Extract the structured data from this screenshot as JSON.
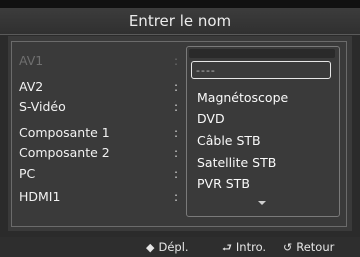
{
  "title": "Entrer le nom",
  "sources": [
    {
      "label": "AV1"
    },
    {
      "label": "AV2"
    },
    {
      "label": "S-Vidéo"
    },
    {
      "label": "Composante 1"
    },
    {
      "label": "Composante 2"
    },
    {
      "label": "PC"
    },
    {
      "label": "HDMI1"
    }
  ],
  "dropdown": {
    "selected": "----",
    "options": [
      "Magnétoscope",
      "DVD",
      "Câble STB",
      "Satellite STB",
      "PVR STB"
    ]
  },
  "footer": {
    "move_icon": "updown-arrows-icon",
    "move_label": "Dépl.",
    "enter_icon": "enter-icon",
    "enter_label": "Intro.",
    "return_icon": "return-icon",
    "return_label": "Retour"
  }
}
